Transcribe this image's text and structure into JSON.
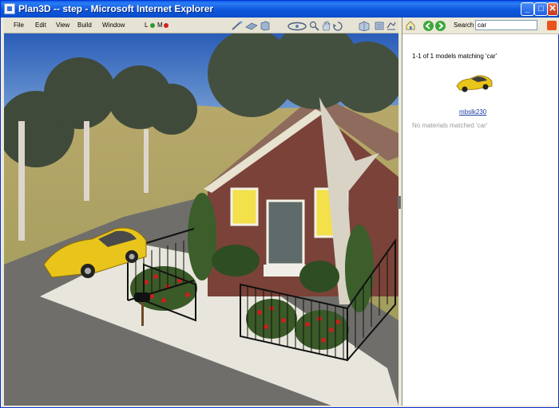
{
  "window": {
    "title": "Plan3D -- step - Microsoft Internet Explorer"
  },
  "titlebar_buttons": {
    "minimize": "_",
    "maximize": "□",
    "close": "✕"
  },
  "menu": {
    "items": [
      {
        "label": "File"
      },
      {
        "label": "Edit"
      },
      {
        "label": "View"
      },
      {
        "label": "Build"
      },
      {
        "label": "Window"
      }
    ],
    "lm_label_l": "L",
    "lm_label_m": "M"
  },
  "status_colors": {
    "l_dot": "#2e9a2e",
    "m_dot": "#d42020"
  },
  "toolbar_icons": [
    "wand-icon",
    "floor-icon",
    "wall-icon",
    "orbit-icon",
    "zoom-icon",
    "pan-hand-icon",
    "rotate-icon",
    "catalog-icon",
    "library-icon",
    "export-icon"
  ],
  "panel": {
    "search_label": "Search",
    "search_value": "car",
    "result_count": "1-1 of 1 models matching 'car'",
    "model_name": "mbslk230",
    "no_materials": "No materials matched 'car'"
  }
}
